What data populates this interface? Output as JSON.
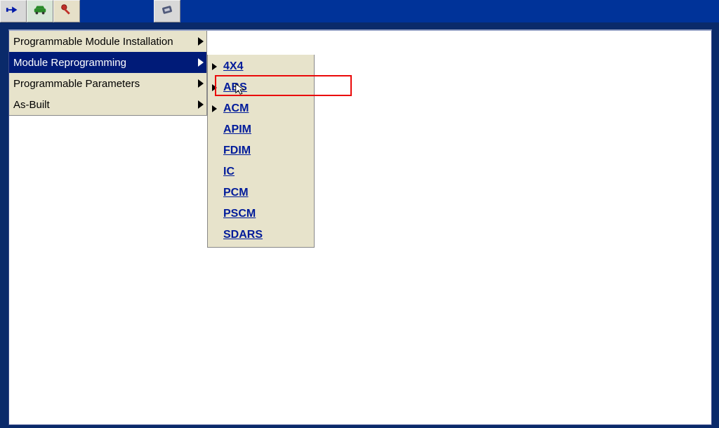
{
  "toolbar": {
    "left": [
      {
        "name": "connector-tool",
        "icon": "plug"
      },
      {
        "name": "vehicle-tool",
        "icon": "car"
      },
      {
        "name": "key-tool",
        "icon": "key"
      }
    ],
    "right": [
      {
        "name": "module-tool",
        "icon": "chip"
      }
    ]
  },
  "menu": [
    {
      "label": "Programmable Module Installation",
      "has_sub": true,
      "selected": false
    },
    {
      "label": "Module Reprogramming",
      "has_sub": true,
      "selected": true
    },
    {
      "label": "Programmable Parameters",
      "has_sub": true,
      "selected": false
    },
    {
      "label": "As-Built",
      "has_sub": true,
      "selected": false
    }
  ],
  "submenu": [
    {
      "label": "4X4",
      "arrow": true
    },
    {
      "label": "ABS",
      "arrow": true,
      "highlighted": true
    },
    {
      "label": "ACM",
      "arrow": true
    },
    {
      "label": "APIM",
      "arrow": false
    },
    {
      "label": "FDIM",
      "arrow": false
    },
    {
      "label": "IC",
      "arrow": false
    },
    {
      "label": "PCM",
      "arrow": false
    },
    {
      "label": "PSCM",
      "arrow": false
    },
    {
      "label": "SDARS",
      "arrow": false
    }
  ]
}
